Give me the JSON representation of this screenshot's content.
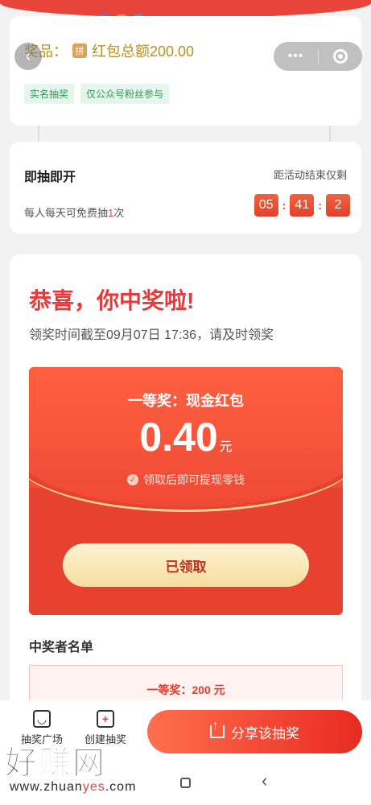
{
  "colors": {
    "accent": "#e8443a",
    "tag_green": "#2e9a55",
    "prize_gold": "#b8911f"
  },
  "nav": {
    "more_glyph": "•••",
    "back_glyph": "‹"
  },
  "prize_card": {
    "prize_label": "奖品：",
    "prize_icon_char": "拼",
    "prize_text": "红包总额200.00",
    "tags": [
      "实名抽奖",
      "仅公众号粉丝参与"
    ]
  },
  "draw_card": {
    "title": "即抽即开",
    "subtitle_prefix": "每人每天可免费抽",
    "subtitle_count": "1",
    "subtitle_suffix": "次",
    "countdown_label": "距活动结束仅剩",
    "countdown": [
      "05",
      "41",
      "2"
    ]
  },
  "result": {
    "title": "恭喜，你中奖啦!",
    "deadline": "领奖时间截至09月07日 17:36，请及时领奖",
    "prize_tier": "一等奖：现金红包",
    "amount": "0.40",
    "unit": "元",
    "note": "领取后即可提现零钱",
    "claimed_button": "已领取"
  },
  "winners": {
    "title": "中奖者名单",
    "row": "一等奖：200 元"
  },
  "bottom_bar": {
    "item1": "抽奖广场",
    "item2": "创建抽奖",
    "share": "分享该抽奖"
  },
  "watermark": {
    "big": "好赚网",
    "small_pre": "www.zhuan",
    "small_hl": "yes",
    "small_post": ".com"
  }
}
